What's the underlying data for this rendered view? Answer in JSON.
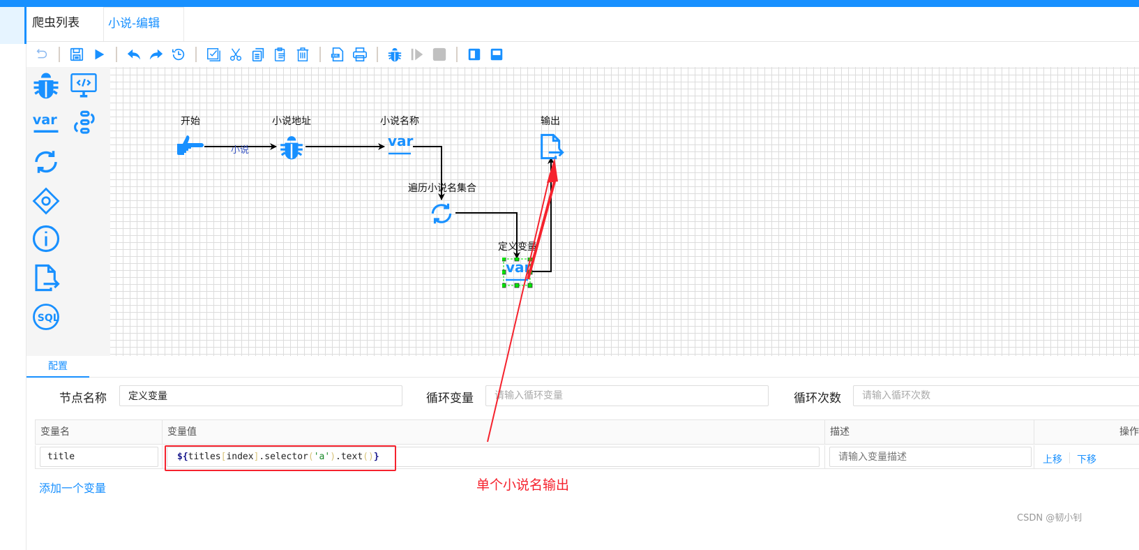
{
  "colors": {
    "accent": "#1890ff",
    "annotation": "#f5222d",
    "handle": "#00e600"
  },
  "tabs": [
    {
      "label": "爬虫列表",
      "active": false
    },
    {
      "label": "小说-编辑",
      "active": true
    }
  ],
  "toolbar": {
    "items": [
      "undo-icon",
      "save-icon",
      "run-icon",
      "back-icon",
      "forward-icon",
      "history-icon",
      "select-all-icon",
      "cut-icon",
      "copy-icon",
      "paste-icon",
      "delete-icon",
      "export-xml-icon",
      "print-icon",
      "debug-icon",
      "resume-icon",
      "stop-icon",
      "toggle-left-panel-icon",
      "toggle-bottom-panel-icon"
    ]
  },
  "palette": {
    "items": [
      "spider-node-icon",
      "script-node-icon",
      "variable-node-icon",
      "process-node-icon",
      "loop-node-icon",
      "condition-node-icon",
      "info-node-icon",
      "output-node-icon",
      "sql-node-icon"
    ]
  },
  "flow": {
    "nodes": [
      {
        "id": "start",
        "label": "开始",
        "type": "start"
      },
      {
        "id": "url",
        "label": "小说地址",
        "type": "spider"
      },
      {
        "id": "names",
        "label": "小说名称",
        "type": "variable"
      },
      {
        "id": "loop",
        "label": "遍历小说名集合",
        "type": "loop"
      },
      {
        "id": "defvar",
        "label": "定义变量",
        "type": "variable",
        "selected": true
      },
      {
        "id": "output",
        "label": "输出",
        "type": "output"
      }
    ],
    "edges": [
      {
        "from": "start",
        "to": "url",
        "label": "小说"
      },
      {
        "from": "url",
        "to": "names",
        "label": ""
      },
      {
        "from": "names",
        "to": "loop",
        "label": ""
      },
      {
        "from": "loop",
        "to": "defvar",
        "label": ""
      },
      {
        "from": "defvar",
        "to": "output",
        "label": ""
      }
    ]
  },
  "config": {
    "tab_label": "配置",
    "node_name_label": "节点名称",
    "node_name_value": "定义变量",
    "loop_var_label": "循环变量",
    "loop_var_placeholder": "请输入循环变量",
    "loop_count_label": "循环次数",
    "loop_count_placeholder": "请输入循环次数",
    "table": {
      "headers": [
        "变量名",
        "变量值",
        "描述",
        "操作"
      ],
      "rows": [
        {
          "name": "title",
          "value": "${titles[index].selector('a').text()}",
          "value_tokens": [
            "${",
            "titles",
            "[",
            "index",
            "]",
            ".selector",
            "(",
            "'a'",
            ")",
            ".text",
            "(",
            ")",
            "}"
          ],
          "description_placeholder": "请输入变量描述",
          "actions": [
            "上移",
            "下移"
          ]
        }
      ]
    },
    "add_variable_label": "添加一个变量"
  },
  "annotation": {
    "text": "单个小说名输出"
  },
  "watermark": "CSDN @韧小钊"
}
